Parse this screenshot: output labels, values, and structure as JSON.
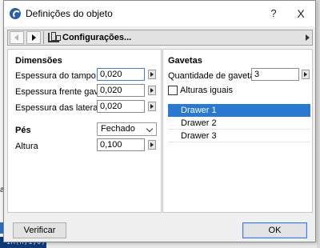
{
  "background": {
    "left_char": "a",
    "left_fragment": "IR(n,1,0)"
  },
  "dialog": {
    "title": "Definições do objeto",
    "help_label": "?",
    "close_label": "X"
  },
  "navbar": {
    "config_label": "Configurações..."
  },
  "dimensoes": {
    "heading": "Dimensões",
    "fields": [
      {
        "label": "Espessura do tampo",
        "value": "0,020"
      },
      {
        "label": "Espessura frente gaveta",
        "value": "0,020"
      },
      {
        "label": "Espessura das laterais",
        "value": "0,020"
      }
    ]
  },
  "pes": {
    "heading": "Pés",
    "select_value": "Fechado",
    "altura_label": "Altura",
    "altura_value": "0,100"
  },
  "gavetas": {
    "heading": "Gavetas",
    "quantidade_label": "Quantidade de gavetas",
    "quantidade_value": "3",
    "alturas_iguais_label": "Alturas iguais",
    "alturas_iguais_checked": false,
    "items": [
      "Drawer 1",
      "Drawer 2",
      "Drawer 3"
    ],
    "selected_index": 0
  },
  "footer": {
    "verificar_label": "Verificar",
    "ok_label": "OK"
  },
  "colors": {
    "accent": "#2a79d0",
    "focus_border": "#3b7dd8"
  }
}
